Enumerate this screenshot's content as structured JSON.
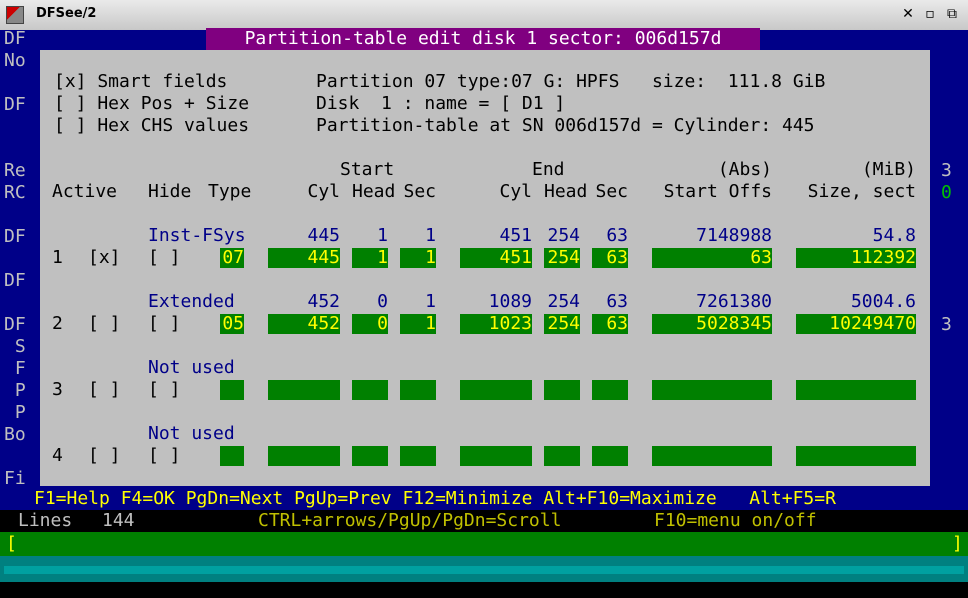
{
  "window": {
    "title": "DFSee/2"
  },
  "dialog": {
    "title": "Partition-table edit disk 1 sector: 006d157d"
  },
  "options": [
    "[x] Smart fields",
    "[ ] Hex Pos + Size",
    "[ ] Hex CHS values"
  ],
  "info": [
    "Partition 07 type:07 G: HPFS   size:  111.8 GiB",
    "Disk  1 : name = [ D1 ]",
    "Partition-table at SN 006d157d = Cylinder: 445"
  ],
  "header": {
    "row1": {
      "start": "Start",
      "end": "End",
      "abs": "(Abs)",
      "mib": "(MiB)"
    },
    "row2": {
      "active": "Active",
      "hide": "Hide",
      "type": "Type",
      "cyl": "Cyl",
      "head": "Head",
      "sec": "Sec",
      "ecyl": "Cyl",
      "ehead": "Head",
      "esec": "Sec",
      "startoffs": "Start Offs",
      "size": "Size, sect"
    }
  },
  "entries": [
    {
      "num": "1",
      "active": "[x]",
      "hide": "[ ]",
      "label": "Inst-FSys",
      "info": {
        "cyl": "445",
        "head": "1",
        "sec": "1",
        "ecyl": "451",
        "ehead": "254",
        "esec": "63",
        "abs": "7148988",
        "mib": "54.8"
      },
      "fields": {
        "type": "07",
        "cyl": "445",
        "head": "1",
        "sec": "1",
        "ecyl": "451",
        "ehead": "254",
        "esec": "63",
        "offs": "63",
        "size": "112392"
      }
    },
    {
      "num": "2",
      "active": "[ ]",
      "hide": "[ ]",
      "label": "Extended",
      "info": {
        "cyl": "452",
        "head": "0",
        "sec": "1",
        "ecyl": "1089",
        "ehead": "254",
        "esec": "63",
        "abs": "7261380",
        "mib": "5004.6"
      },
      "fields": {
        "type": "05",
        "cyl": "452",
        "head": "0",
        "sec": "1",
        "ecyl": "1023",
        "ehead": "254",
        "esec": "63",
        "offs": "5028345",
        "size": "10249470"
      }
    },
    {
      "num": "3",
      "active": "[ ]",
      "hide": "[ ]",
      "label": "Not used",
      "info": {
        "cyl": "",
        "head": "",
        "sec": "",
        "ecyl": "",
        "ehead": "",
        "esec": "",
        "abs": "",
        "mib": ""
      },
      "fields": {
        "type": "",
        "cyl": "",
        "head": "",
        "sec": "",
        "ecyl": "",
        "ehead": "",
        "esec": "",
        "offs": "",
        "size": ""
      }
    },
    {
      "num": "4",
      "active": "[ ]",
      "hide": "[ ]",
      "label": "Not used",
      "info": {
        "cyl": "",
        "head": "",
        "sec": "",
        "ecyl": "",
        "ehead": "",
        "esec": "",
        "abs": "",
        "mib": ""
      },
      "fields": {
        "type": "",
        "cyl": "",
        "head": "",
        "sec": "",
        "ecyl": "",
        "ehead": "",
        "esec": "",
        "offs": "",
        "size": ""
      }
    }
  ],
  "background_left": [
    "DF",
    "No",
    "DF",
    "Re",
    "RC",
    "DF",
    "DF",
    "DF",
    " S",
    " F",
    " P",
    " P",
    "Bo",
    "Fi"
  ],
  "background_right": [
    "3",
    "0",
    "3"
  ],
  "helpbar": "F1=Help F4=OK PgDn=Next PgUp=Prev F12=Minimize Alt+F10=Maximize   Alt+F5=R",
  "status": {
    "lines_label": "Lines",
    "lines_value": "144",
    "scroll_hint": "CTRL+arrows/PgUp/PgDn=Scroll",
    "menu_hint": "F10=menu on/off"
  },
  "cmdline": {
    "left": "[",
    "right": "]"
  },
  "colors": {
    "terminal_bg": "#000088",
    "dialog_bg": "#c0c0c0",
    "field_bg": "#008000",
    "field_fg": "#ffff00",
    "title_bg": "#800080"
  }
}
